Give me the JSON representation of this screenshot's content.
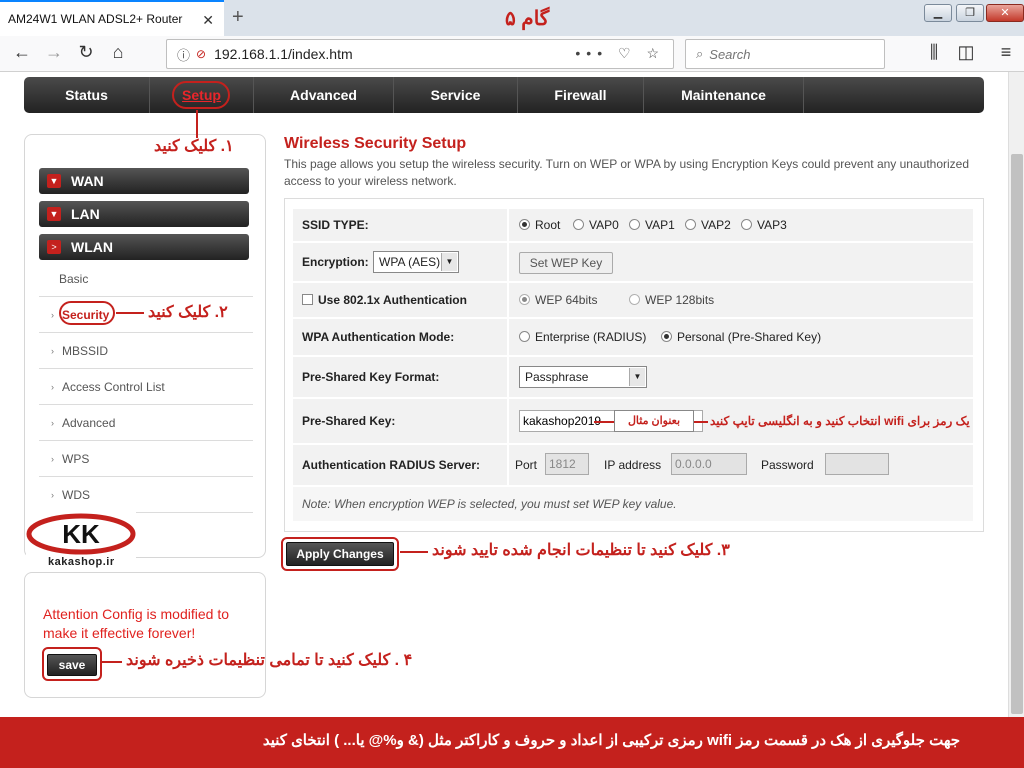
{
  "browser": {
    "tab_title": "AM24W1 WLAN ADSL2+ Router",
    "url": "192.168.1.1/index.htm",
    "search_placeholder": "Search",
    "overlay_title": "گام ۵"
  },
  "menu": {
    "items": [
      {
        "label": "Status",
        "active": false
      },
      {
        "label": "Setup",
        "active": true
      },
      {
        "label": "Advanced",
        "active": false
      },
      {
        "label": "Service",
        "active": false
      },
      {
        "label": "Firewall",
        "active": false
      },
      {
        "label": "Maintenance",
        "active": false
      }
    ]
  },
  "sidebar": {
    "groups": [
      "WAN",
      "LAN",
      "WLAN"
    ],
    "wlan_items": [
      "Basic",
      "Security",
      "MBSSID",
      "Access Control List",
      "Advanced",
      "WPS",
      "WDS"
    ],
    "logo_text": "kakashop.ir"
  },
  "attention": {
    "message": "Attention Config is modified to make it effective forever!",
    "save_label": "save"
  },
  "main": {
    "title": "Wireless Security Setup",
    "description": "This page allows you setup the wireless security. Turn on WEP or WPA by using Encryption Keys could prevent any unauthorized access to your wireless network.",
    "ssid_type": {
      "label": "SSID TYPE:",
      "options": [
        "Root",
        "VAP0",
        "VAP1",
        "VAP2",
        "VAP3"
      ],
      "selected": "Root"
    },
    "encryption": {
      "label": "Encryption:",
      "value": "WPA (AES)",
      "wep_button": "Set WEP Key"
    },
    "use8021x": {
      "label": "Use 802.1x Authentication",
      "options": [
        "WEP 64bits",
        "WEP 128bits"
      ],
      "selected": "WEP 64bits"
    },
    "wpa_auth_mode": {
      "label": "WPA Authentication Mode:",
      "options": [
        "Enterprise (RADIUS)",
        "Personal (Pre-Shared Key)"
      ],
      "selected": "Personal (Pre-Shared Key)"
    },
    "psk_format": {
      "label": "Pre-Shared Key Format:",
      "value": "Passphrase"
    },
    "psk": {
      "label": "Pre-Shared Key:",
      "value": "kakashop2019",
      "example_note": "بعنوان مثال"
    },
    "radius": {
      "label": "Authentication RADIUS Server:",
      "port_label": "Port",
      "port_value": "1812",
      "ip_label": "IP address",
      "ip_value": "0.0.0.0",
      "password_label": "Password",
      "password_value": ""
    },
    "note": "Note: When encryption WEP is selected, you must set WEP key value.",
    "apply_label": "Apply Changes"
  },
  "annotations": {
    "step1": "۱. کلیک کنید",
    "step2": "۲. کلیک کنید",
    "step3": "۳. کلیک کنید تا تنظیمات انجام شده تایید شوند",
    "step4": "۴ . کلیک کنید تا تمامی تنظیمات ذخیره شوند",
    "psk_hint": "یک رمز برای wifi انتخاب کنید و به انگلیسی تایپ کنید",
    "banner": "جهت جلوگیری از هک در قسمت رمز wifi رمزی ترکیبی از اعداد و حروف و کاراکتر مثل (& و%@ یا... ) انتخای کنید"
  },
  "colors": {
    "accent": "#c4211d",
    "menu_bg": "#2b2b2b",
    "banner_bg": "#c4211d"
  }
}
